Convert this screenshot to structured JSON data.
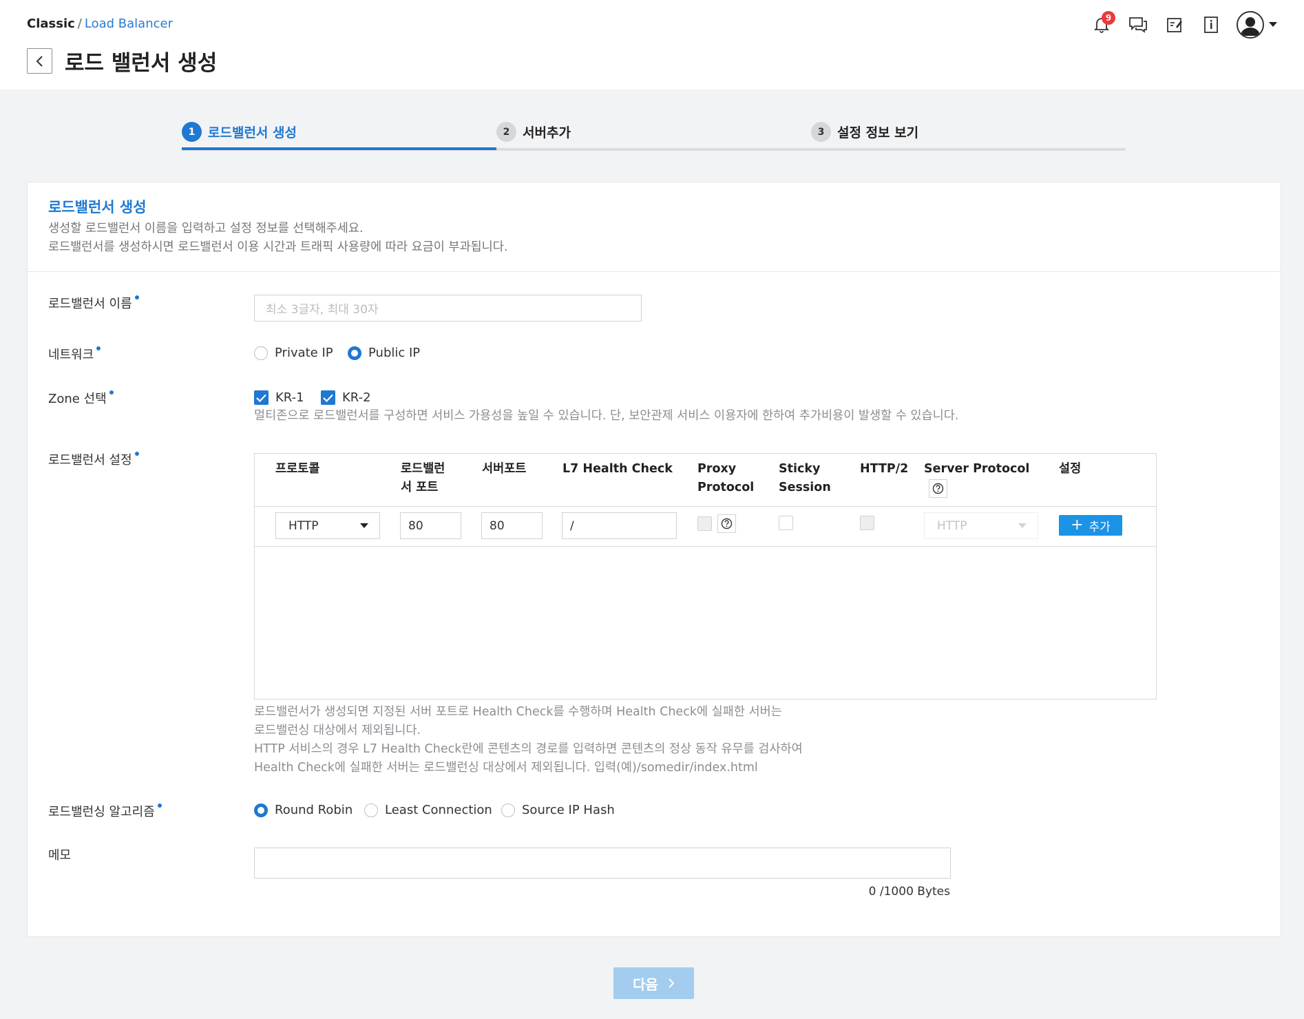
{
  "breadcrumb": {
    "root": "Classic",
    "separator": "/",
    "current": "Load Balancer"
  },
  "page_title": "로드 밸런서 생성",
  "notifications": {
    "count": "9"
  },
  "icons": [
    "bell-icon",
    "chat-icon",
    "note-icon",
    "info-book-icon",
    "user-icon"
  ],
  "steps": [
    {
      "num": "1",
      "label": "로드밸런서 생성",
      "active": true
    },
    {
      "num": "2",
      "label": "서버추가",
      "active": false
    },
    {
      "num": "3",
      "label": "설정 정보 보기",
      "active": false
    }
  ],
  "card": {
    "title": "로드밸런서 생성",
    "desc1": "생성할 로드밸런서 이름을 입력하고 설정 정보를 선택해주세요.",
    "desc2": "로드밸런서를 생성하시면 로드밸런서 이용 시간과 트래픽 사용량에 따라 요금이 부과됩니다."
  },
  "form": {
    "name_label": "로드밸런서 이름",
    "name_placeholder": "최소 3글자, 최대 30자",
    "network_label": "네트워크",
    "network_options": [
      "Private IP",
      "Public IP"
    ],
    "network_selected": "Public IP",
    "zone_label": "Zone 선택",
    "zones": [
      "KR-1",
      "KR-2"
    ],
    "zone_help": "멀티존으로 로드밸런서를 구성하면 서비스 가용성을 높일 수 있습니다. 단, 보안관제 서비스 이용자에 한하여 추가비용이 발생할 수 있습니다.",
    "lb_setting_label": "로드밸런서 설정",
    "table_headers": {
      "protocol": "프로토콜",
      "lb_port_1": "로드밸런",
      "lb_port_2": "서 포트",
      "server_port": "서버포트",
      "l7": "L7 Health Check",
      "proxy_1": "Proxy",
      "proxy_2": "Protocol",
      "sticky_1": "Sticky",
      "sticky_2": "Session",
      "http2": "HTTP/2",
      "server_protocol": "Server Protocol",
      "setting": "설정"
    },
    "row": {
      "protocol": "HTTP",
      "lb_port": "80",
      "server_port": "80",
      "l7_path": "/",
      "server_protocol": "HTTP",
      "add_label": "추가"
    },
    "lb_help": [
      "로드밸런서가 생성되면 지정된 서버 포트로 Health Check를 수행하며 Health Check에 실패한 서버는",
      "로드밸런싱 대상에서 제외됩니다.",
      "HTTP 서비스의 경우 L7 Health Check란에 콘텐츠의 경로를 입력하면 콘텐츠의 정상 동작 유무를 검사하여",
      "Health Check에 실패한 서버는 로드밸런싱 대상에서 제외됩니다. 입력(예)/somedir/index.html"
    ],
    "algo_label": "로드밸런싱 알고리즘",
    "algo_options": [
      "Round Robin",
      "Least Connection",
      "Source IP Hash"
    ],
    "algo_selected": "Round Robin",
    "memo_label": "메모",
    "memo_bytes": "0 /1000 Bytes"
  },
  "next_button": "다음",
  "colors": {
    "accent": "#1f78d1",
    "add_button": "#1b93e6",
    "next_disabled": "#a3ccef",
    "badge": "#ec3a3a"
  }
}
